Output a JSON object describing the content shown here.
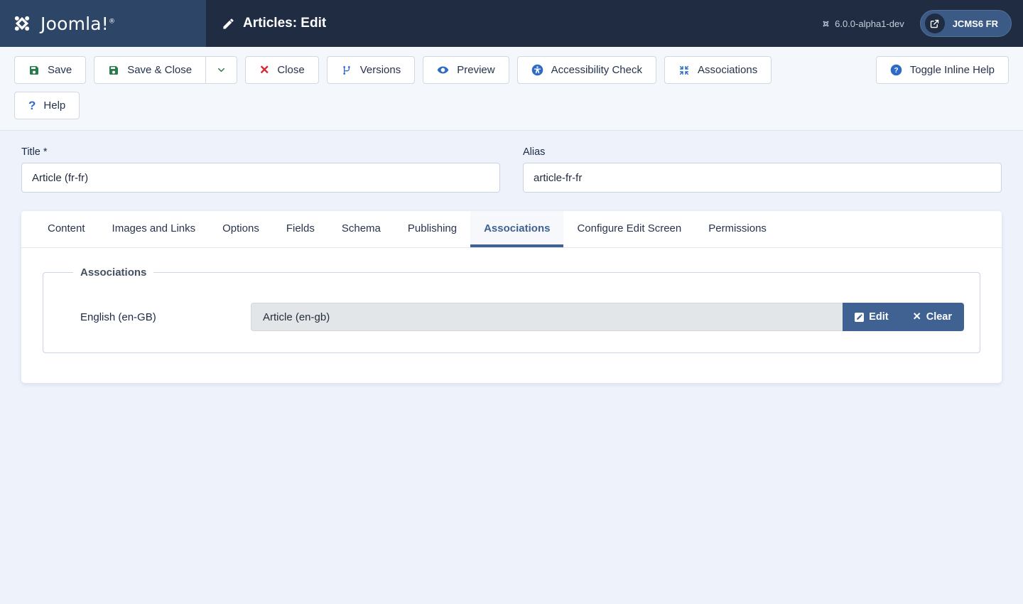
{
  "header": {
    "brand_name": "Joomla!",
    "brand_registered": "®",
    "brand_icon": "joomla-logo-icon",
    "title": "Articles: Edit",
    "title_icon": "pencil-icon",
    "version": "6.0.0-alpha1-dev",
    "version_icon": "joomla-mark-icon",
    "user_label": "JCMS6 FR",
    "user_icon": "external-link-icon",
    "brand_bg": "#2d4668",
    "bar_bg": "#1f2c42"
  },
  "toolbar": {
    "buttons": [
      {
        "label": "Save",
        "icon": "save-icon",
        "name": "save-button"
      },
      {
        "label": "Save & Close",
        "icon": "save-icon",
        "name": "save-and-close-button"
      },
      {
        "label": "Close",
        "icon": "close-x-icon",
        "name": "close-button"
      },
      {
        "label": "Versions",
        "icon": "code-branch-icon",
        "name": "versions-button"
      },
      {
        "label": "Preview",
        "icon": "eye-icon",
        "name": "preview-button"
      },
      {
        "label": "Accessibility Check",
        "icon": "accessibility-icon",
        "name": "accessibility-check-button"
      },
      {
        "label": "Associations",
        "icon": "arrows-in-icon",
        "name": "associations-button"
      },
      {
        "label": "Toggle Inline Help",
        "icon": "question-circle-icon",
        "name": "toggle-inline-help-button"
      },
      {
        "label": "Help",
        "icon": "question-mark-icon",
        "name": "help-button"
      }
    ],
    "dropdown_icon": "chevron-down-icon",
    "save_icon_color": "#2b7a4b",
    "close_icon_color": "#d9232d",
    "info_icon_color": "#2d6bc4"
  },
  "form": {
    "title": {
      "label": "Title",
      "required_marker": "*",
      "value": "Article (fr-fr)",
      "placeholder": ""
    },
    "alias": {
      "label": "Alias",
      "value": "article-fr-fr",
      "placeholder": ""
    }
  },
  "tabs": {
    "items": [
      {
        "label": "Content",
        "name": "tab-content",
        "active": false
      },
      {
        "label": "Images and Links",
        "name": "tab-images-and-links",
        "active": false
      },
      {
        "label": "Options",
        "name": "tab-options",
        "active": false
      },
      {
        "label": "Fields",
        "name": "tab-fields",
        "active": false
      },
      {
        "label": "Schema",
        "name": "tab-schema",
        "active": false
      },
      {
        "label": "Publishing",
        "name": "tab-publishing",
        "active": false
      },
      {
        "label": "Associations",
        "name": "tab-associations",
        "active": true
      },
      {
        "label": "Configure Edit Screen",
        "name": "tab-configure-edit-screen",
        "active": false
      },
      {
        "label": "Permissions",
        "name": "tab-permissions",
        "active": false
      }
    ],
    "active_color": "#3f6293"
  },
  "associations_panel": {
    "legend": "Associations",
    "rows": [
      {
        "language_label": "English (en-GB)",
        "value": "Article (en-gb)",
        "edit_label": "Edit",
        "edit_icon": "pencil-square-icon",
        "clear_label": "Clear",
        "clear_icon": "close-x-icon"
      }
    ],
    "button_bg": "#3f6293",
    "input_bg": "#e3e6e9"
  },
  "page": {
    "background": "#edf2fb"
  }
}
